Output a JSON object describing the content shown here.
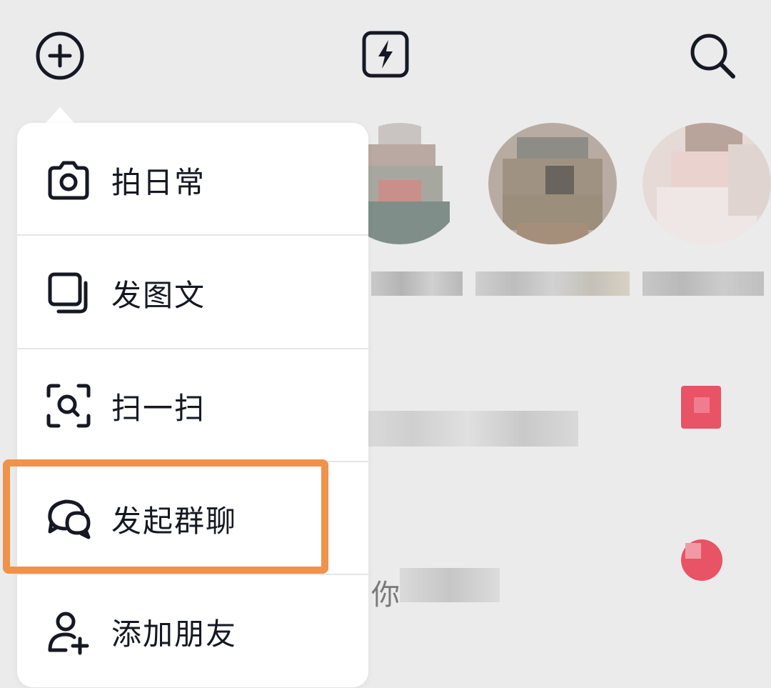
{
  "topbar": {
    "left_icon": "add-circle-icon",
    "center_icon": "lightning-icon",
    "right_icon": "search-icon"
  },
  "background": {
    "snippet_prefix": "你",
    "unread_badge_color": "#e8384f"
  },
  "menu": {
    "items": [
      {
        "label": "拍日常",
        "icon": "camera-icon"
      },
      {
        "label": "发图文",
        "icon": "image-text-icon"
      },
      {
        "label": "扫一扫",
        "icon": "scan-icon"
      },
      {
        "label": "发起群聊",
        "icon": "group-chat-icon",
        "highlighted": true
      },
      {
        "label": "添加朋友",
        "icon": "add-friend-icon"
      }
    ]
  },
  "colors": {
    "background": "#ebebeb",
    "menu_bg": "#ffffff",
    "text": "#161823",
    "highlight": "#f0924a"
  }
}
